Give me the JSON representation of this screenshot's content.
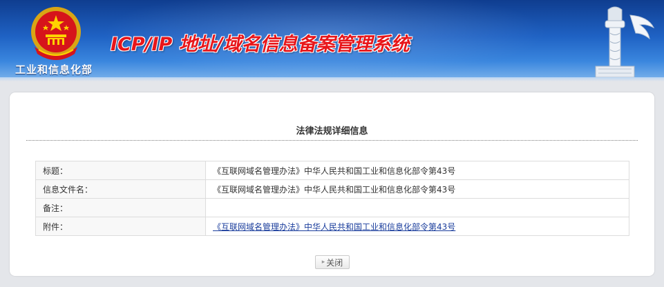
{
  "header": {
    "ministry_name": "工业和信息化部",
    "system_title": "ICP/IP 地址/域名信息备案管理系统",
    "emblem_icon": "national-emblem-icon",
    "pillar_icon": "huabiao-pillar-icon"
  },
  "detail": {
    "title": "法律法规详细信息",
    "rows": [
      {
        "label": "标题：",
        "value": "《互联网域名管理办法》中华人民共和国工业和信息化部令第43号"
      },
      {
        "label": "信息文件名：",
        "value": "《互联网域名管理办法》中华人民共和国工业和信息化部令第43号"
      },
      {
        "label": "备注：",
        "value": ""
      },
      {
        "label": "附件：",
        "value": "《互联网域名管理办法》中华人民共和国工业和信息化部令第43号"
      }
    ],
    "close_label": "关闭"
  },
  "colors": {
    "banner_top": "#0f3d8f",
    "banner_bottom": "#7fb5ec",
    "title_red": "#e8161a",
    "link_blue": "#1a3d9c"
  }
}
